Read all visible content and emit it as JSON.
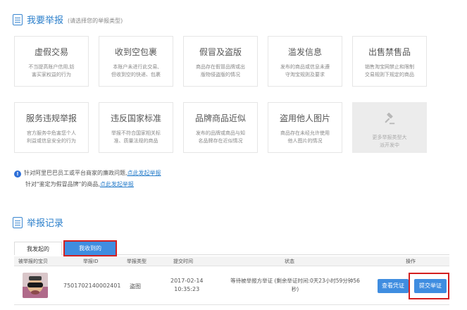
{
  "report_section": {
    "title": "我要举报",
    "hint": "(请选择您的举报类型)",
    "cards": [
      {
        "title": "虚假交易",
        "desc": [
          "不当提高账户信用,妨",
          "害买家权益的行为"
        ]
      },
      {
        "title": "收到空包裹",
        "desc": [
          "本账户未进行此交易,",
          "但收到空的快递、包裹"
        ]
      },
      {
        "title": "假冒及盗版",
        "desc": [
          "商品存在假冒品牌或出",
          "版物侵盗版的情况"
        ]
      },
      {
        "title": "滥发信息",
        "desc": [
          "发布的商品或信息未遵",
          "守淘宝规则及要求"
        ]
      },
      {
        "title": "出售禁售品",
        "desc": [
          "销售淘宝网禁止和限制",
          "交易规则下规定的商品"
        ]
      },
      {
        "title": "服务违规举报",
        "desc": [
          "官方服务中危害您个人",
          "利益或信息安全的行为"
        ]
      },
      {
        "title": "违反国家标准",
        "desc": [
          "举报不符合国家相关标",
          "准、质量法规的商品"
        ]
      },
      {
        "title": "品牌商品近似",
        "desc": [
          "发布的品牌或商品与知",
          "名品牌存在近似情况"
        ]
      },
      {
        "title": "盗用他人图片",
        "desc": [
          "商品存在未经允许使用",
          "他人图片的情况"
        ]
      }
    ],
    "more_card": {
      "icon": "gavel-icon",
      "desc": [
        "更多举报类型大",
        "派开发中"
      ]
    }
  },
  "notice": {
    "line1_text": "针对阿里巴巴员工或平台商家的廉政问题,",
    "line1_link": "点此发起举报",
    "line2_text": "针对\"鉴定为假冒品牌\"的商品,",
    "line2_link": "点此发起举报"
  },
  "records_section": {
    "title": "举报记录",
    "tabs": {
      "sent": "我发起的",
      "received": "我收到的"
    },
    "columns": {
      "item": "被举报的宝贝",
      "report_id": "举报ID",
      "type": "举报类型",
      "time": "提交时间",
      "status": "状态",
      "action": "操作"
    },
    "rows": [
      {
        "report_id": "7501702140002401",
        "type": "盗图",
        "date": "2017-02-14",
        "time": "10:35:23",
        "status_line1": "等待被举报方举证 (剩余举证时间:0天23小时59分钟56",
        "status_line2": "秒)",
        "view_button": "查看凭证",
        "submit_button": "提交举证"
      }
    ]
  },
  "colors": {
    "accent": "#3f8de0",
    "highlight": "#d42020"
  }
}
